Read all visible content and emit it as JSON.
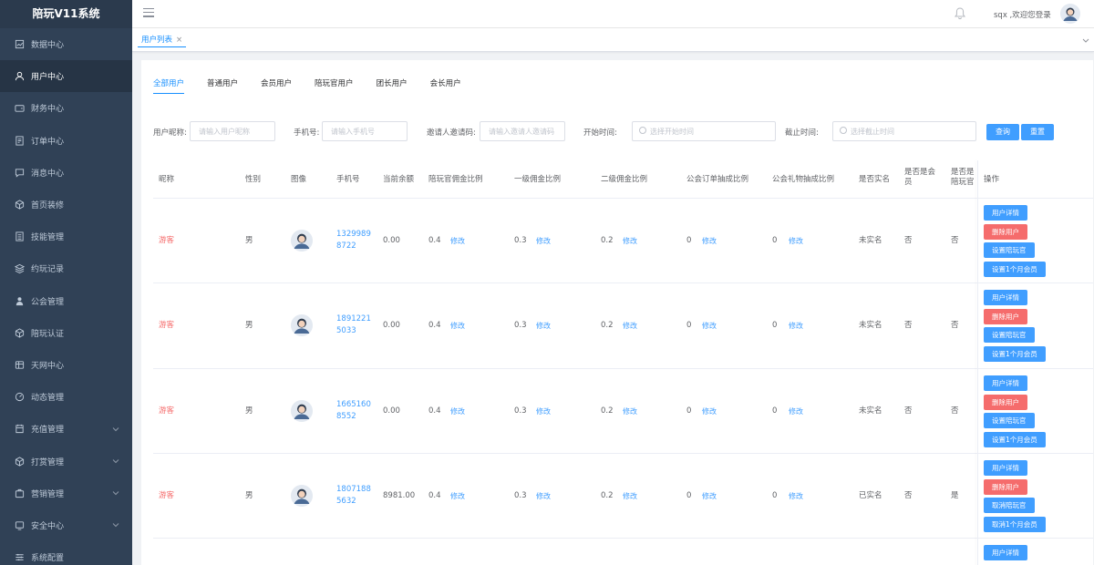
{
  "app": {
    "title": "陪玩V11系统"
  },
  "sidebar": {
    "items": [
      {
        "label": "数据中心",
        "icon": "chart-icon"
      },
      {
        "label": "用户中心",
        "icon": "user-icon",
        "active": true
      },
      {
        "label": "财务中心",
        "icon": "wallet-icon"
      },
      {
        "label": "订单中心",
        "icon": "order-icon"
      },
      {
        "label": "消息中心",
        "icon": "message-icon"
      },
      {
        "label": "首页装修",
        "icon": "cube-icon"
      },
      {
        "label": "技能管理",
        "icon": "list-icon"
      },
      {
        "label": "约玩记录",
        "icon": "layers-icon"
      },
      {
        "label": "公会管理",
        "icon": "guild-icon"
      },
      {
        "label": "陪玩认证",
        "icon": "cube-icon"
      },
      {
        "label": "天网中心",
        "icon": "globe-icon"
      },
      {
        "label": "动态管理",
        "icon": "dashboard-icon"
      },
      {
        "label": "充值管理",
        "icon": "recharge-icon",
        "expandable": true
      },
      {
        "label": "打赏管理",
        "icon": "cube-icon",
        "expandable": true
      },
      {
        "label": "营销管理",
        "icon": "marketing-icon",
        "expandable": true
      },
      {
        "label": "安全中心",
        "icon": "security-icon",
        "expandable": true
      },
      {
        "label": "系统配置",
        "icon": "config-icon"
      }
    ]
  },
  "header": {
    "welcome": "sqx ,欢迎您登录"
  },
  "tabs": {
    "active_label": "用户列表",
    "close": "×"
  },
  "subtabs": [
    "全部用户",
    "普通用户",
    "会员用户",
    "陪玩官用户",
    "团长用户",
    "会长用户"
  ],
  "filters": {
    "nickname": {
      "label": "用户昵称:",
      "placeholder": "请输入用户昵称"
    },
    "phone": {
      "label": "手机号:",
      "placeholder": "请输入手机号"
    },
    "invite": {
      "label": "邀请人邀请码:",
      "placeholder": "请输入邀请人邀请码"
    },
    "start": {
      "label": "开始时间:",
      "placeholder": "选择开始时间"
    },
    "end": {
      "label": "截止时间:",
      "placeholder": "选择截止时间"
    },
    "search_button": "查询",
    "reset_button": "重置"
  },
  "table": {
    "headers": [
      "昵称",
      "性别",
      "图像",
      "手机号",
      "当前余额",
      "陪玩官佣金比例",
      "一级佣金比例",
      "二级佣金比例",
      "公会订单抽成比例",
      "公会礼物抽成比例",
      "是否实名",
      "是否是会员",
      "是否是陪玩官",
      "操作"
    ],
    "edit_label": "修改",
    "rows": [
      {
        "nickname": "游客",
        "gender": "男",
        "phone": "13299898722",
        "balance": "0.00",
        "companion_rate": "0.4",
        "level1_rate": "0.3",
        "level2_rate": "0.2",
        "guild_order_rate": "0",
        "guild_gift_rate": "0",
        "verified": "未实名",
        "member": "否",
        "companion": "否"
      },
      {
        "nickname": "游客",
        "gender": "男",
        "phone": "18912215033",
        "balance": "0.00",
        "companion_rate": "0.4",
        "level1_rate": "0.3",
        "level2_rate": "0.2",
        "guild_order_rate": "0",
        "guild_gift_rate": "0",
        "verified": "未实名",
        "member": "否",
        "companion": "否"
      },
      {
        "nickname": "游客",
        "gender": "男",
        "phone": "16651608552",
        "balance": "0.00",
        "companion_rate": "0.4",
        "level1_rate": "0.3",
        "level2_rate": "0.2",
        "guild_order_rate": "0",
        "guild_gift_rate": "0",
        "verified": "未实名",
        "member": "否",
        "companion": "否"
      },
      {
        "nickname": "游客",
        "gender": "男",
        "phone": "18071885632",
        "balance": "8981.00",
        "companion_rate": "0.4",
        "level1_rate": "0.3",
        "level2_rate": "0.2",
        "guild_order_rate": "0",
        "guild_gift_rate": "0",
        "verified": "已实名",
        "member": "否",
        "companion": "是"
      }
    ],
    "actions": [
      "用户详情",
      "删除用户",
      "设置陪玩官",
      "设置1个月会员"
    ],
    "actions_row4": [
      "用户详情",
      "删除用户",
      "取消陪玩官",
      "取消1个月会员"
    ]
  },
  "colors": {
    "sidebar_bg": "#304156",
    "primary": "#409eff",
    "danger": "#f56c6c"
  }
}
